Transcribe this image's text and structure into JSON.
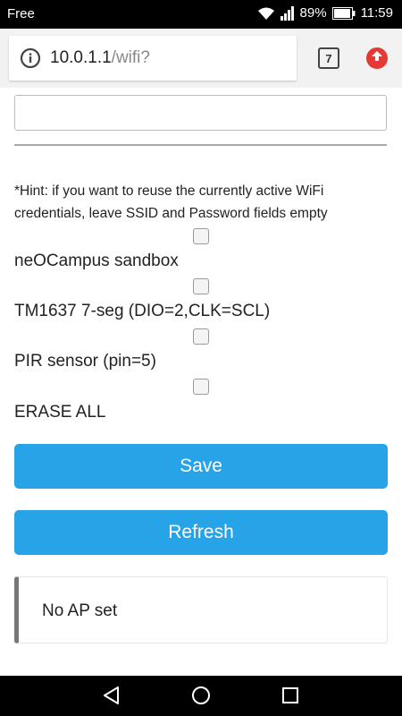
{
  "status_bar": {
    "carrier": "Free",
    "battery_percent": "89%",
    "time": "11:59"
  },
  "browser": {
    "url_host": "10.0.1.1",
    "url_path": "/wifi?",
    "tab_count": "7"
  },
  "form": {
    "text_input_value": "",
    "hint": "*Hint: if you want to reuse the currently active WiFi credentials, leave SSID and Password fields empty",
    "options": [
      {
        "label": "neOCampus sandbox",
        "checked": false
      },
      {
        "label": "TM1637 7-seg (DIO=2,CLK=SCL)",
        "checked": false
      },
      {
        "label": "PIR sensor (pin=5)",
        "checked": false
      },
      {
        "label": "ERASE ALL",
        "checked": false
      }
    ],
    "save_label": "Save",
    "refresh_label": "Refresh"
  },
  "message": {
    "text": "No AP set"
  },
  "colors": {
    "button": "#27a3e8",
    "update_badge": "#e53935"
  }
}
